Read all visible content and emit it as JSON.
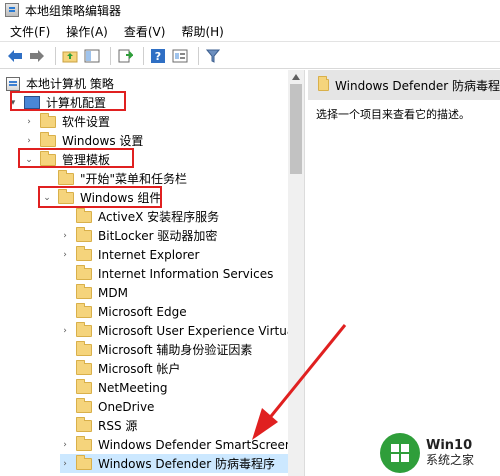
{
  "window": {
    "title": "本地组策略编辑器"
  },
  "menu": [
    "文件(F)",
    "操作(A)",
    "查看(V)",
    "帮助(H)"
  ],
  "tree": {
    "root": "本地计算机 策略",
    "computer_config": "计算机配置",
    "software_settings": "软件设置",
    "windows_settings": "Windows 设置",
    "admin_templates": "管理模板",
    "start_menu": "\"开始\"菜单和任务栏",
    "windows_components": "Windows 组件",
    "children": [
      "ActiveX 安装程序服务",
      "BitLocker 驱动器加密",
      "Internet Explorer",
      "Internet Information Services",
      "MDM",
      "Microsoft Edge",
      "Microsoft User Experience Virtualiz",
      "Microsoft 辅助身份验证因素",
      "Microsoft 帐户",
      "NetMeeting",
      "OneDrive",
      "RSS 源",
      "Windows Defender SmartScreen",
      "Windows Defender 防病毒程序"
    ]
  },
  "right": {
    "header": "Windows Defender 防病毒程",
    "description": "选择一个项目来查看它的描述。"
  },
  "watermark": {
    "line1": "Win10",
    "line2": "系统之家"
  },
  "colors": {
    "highlight": "#e02020",
    "selection": "#cce8ff",
    "folder": "#f5d47c"
  }
}
